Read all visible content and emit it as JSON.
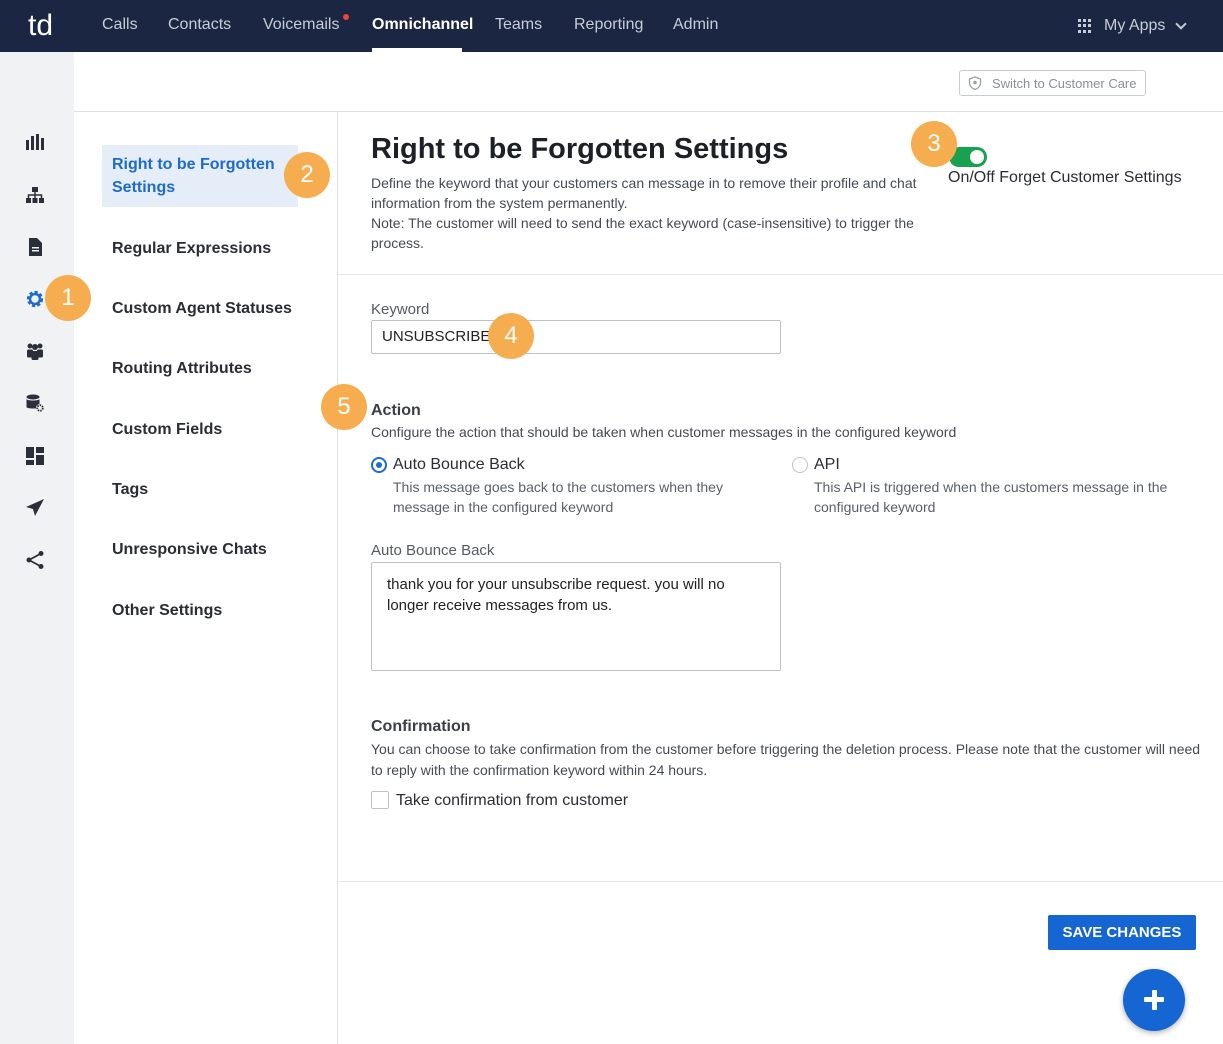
{
  "top_nav": {
    "logo_text": "td",
    "items": [
      "Calls",
      "Contacts",
      "Voicemails",
      "Omnichannel",
      "Teams",
      "Reporting",
      "Admin"
    ],
    "active": "Omnichannel",
    "my_apps": "My Apps"
  },
  "rail_icons": [
    "bar-chart-icon",
    "org-chart-icon",
    "document-icon",
    "gear-icon",
    "team-icon",
    "database-settings-icon",
    "dashboard-icon",
    "send-icon",
    "share-icon"
  ],
  "subheader": {
    "switch_label": "Switch to Customer Care"
  },
  "sec_nav": {
    "active_label": "Right to be Forgotten Settings",
    "items": [
      "Regular Expressions",
      "Custom Agent Statuses",
      "Routing Attributes",
      "Custom Fields",
      "Tags",
      "Unresponsive Chats",
      "Other Settings"
    ]
  },
  "main": {
    "title": "Right to be Forgotten Settings",
    "description_1": "Define the keyword that your customers can message in to remove their profile and chat information from the system permanently.",
    "description_2": "Note: The customer will need to send the exact keyword (case-insensitive) to trigger the process.",
    "toggle_label": "On/Off Forget Customer Settings",
    "toggle_on": true,
    "keyword_label": "Keyword",
    "keyword_value": "UNSUBSCRIBE",
    "action_title": "Action",
    "action_desc": "Configure the action that should be taken when customer messages in the configured keyword",
    "option_bounce_label": "Auto Bounce Back",
    "option_bounce_desc": "This message goes back to the customers when they message in the configured keyword",
    "option_api_label": "API",
    "option_api_desc": "This API is triggered when the customers message in the configured keyword",
    "bounce_label": "Auto Bounce Back",
    "bounce_text": "thank you for your unsubscribe request. you will no longer receive messages from us.",
    "confirmation_title": "Confirmation",
    "confirmation_desc": "You can choose to take confirmation from the customer before triggering the deletion process. Please note that the customer will need to reply with the confirmation keyword within 24 hours.",
    "checkbox_label": "Take confirmation from customer",
    "save_label": "SAVE CHANGES"
  },
  "callouts": [
    "1",
    "2",
    "3",
    "4",
    "5"
  ],
  "colors": {
    "nav_bg": "#1b2742",
    "primary": "#1565d2",
    "toggle_on": "#1aa14f",
    "callout": "#f6ad4f"
  }
}
